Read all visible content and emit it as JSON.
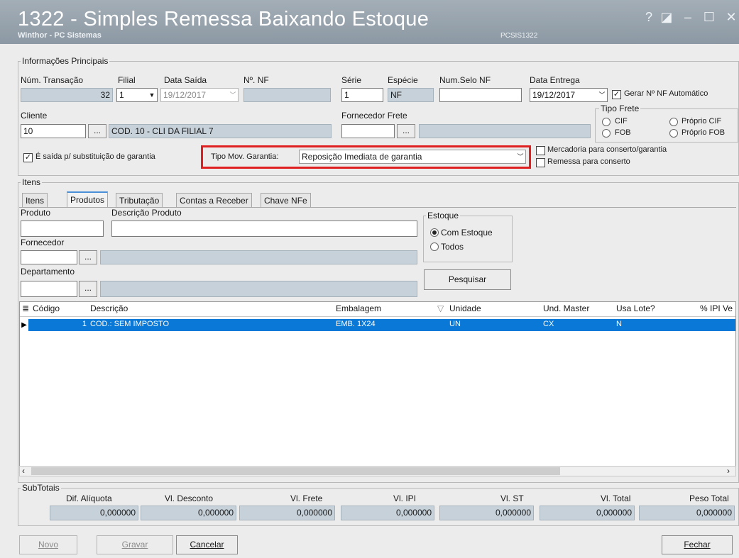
{
  "window": {
    "title": "1322 - Simples Remessa Baixando Estoque",
    "subtitle": "Winthor - PC Sistemas",
    "routine_code": "PCSIS1322",
    "controls": [
      "?",
      "◪",
      "–",
      "☐",
      "✕"
    ]
  },
  "principal": {
    "group_title": "Informações Principais",
    "num_transacao_label": "Núm. Transação",
    "num_transacao_value": "32",
    "filial_label": "Filial",
    "filial_value": "1",
    "data_saida_label": "Data Saída",
    "data_saida_value": "19/12/2017",
    "nf_label": "Nº. NF",
    "nf_value": "",
    "serie_label": "Série",
    "serie_value": "1",
    "especie_label": "Espécie",
    "especie_value": "NF",
    "num_selo_label": "Num.Selo NF",
    "num_selo_value": "",
    "data_entrega_label": "Data Entrega",
    "data_entrega_value": "19/12/2017",
    "gerar_nf_label": "Gerar Nº NF Automático",
    "gerar_nf_checked": true,
    "cliente_label": "Cliente",
    "cliente_code": "10",
    "cliente_name": "COD. 10 - CLI DA FILIAL 7",
    "fornecedor_frete_label": "Fornecedor Frete",
    "fornecedor_frete_code": "",
    "fornecedor_frete_name": "",
    "tipo_frete_title": "Tipo Frete",
    "tipo_frete_options": [
      "CIF",
      "Próprio CIF",
      "FOB",
      "Próprio FOB"
    ],
    "garantia_label": "É saída p/ substituição de garantia",
    "garantia_checked": true,
    "tipo_mov_label": "Tipo Mov. Garantia:",
    "tipo_mov_value": "Reposição Imediata de garantia",
    "mercadoria_conserto_label": "Mercadoria para conserto/garantia",
    "remessa_conserto_label": "Remessa para conserto",
    "ellipsis": "..."
  },
  "itens": {
    "group_title": "Itens",
    "tabs": [
      "Itens",
      "Produtos",
      "Tributação",
      "Contas a Receber",
      "Chave NFe"
    ],
    "active_tab": "Produtos",
    "produto_label": "Produto",
    "descricao_label": "Descrição Produto",
    "fornecedor_label": "Fornecedor",
    "departamento_label": "Departamento",
    "estoque_title": "Estoque",
    "com_estoque_label": "Com Estoque",
    "todos_label": "Todos",
    "pesquisar_label": "Pesquisar"
  },
  "grid": {
    "columns": [
      "Código",
      "Descrição",
      "Embalagem",
      "Unidade",
      "Und. Master",
      "Usa Lote?",
      "% IPI Ve"
    ],
    "rows": [
      {
        "codigo": "1",
        "descricao": "COD.: SEM IMPOSTO",
        "embalagem": "EMB. 1X24",
        "unidade": "UN",
        "und_master": "CX",
        "usa_lote": "N"
      }
    ]
  },
  "subtotais": {
    "title": "SubTotais",
    "labels": [
      "Dif. Alíquota",
      "Vl. Desconto",
      "Vl. Frete",
      "Vl. IPI",
      "Vl. ST",
      "Vl. Total",
      "Peso Total"
    ],
    "values": [
      "0,000000",
      "0,000000",
      "0,000000",
      "0,000000",
      "0,000000",
      "0,000000",
      "0,000000"
    ]
  },
  "footer": {
    "novo": "Novo",
    "gravar": "Gravar",
    "cancelar": "Cancelar",
    "fechar": "Fechar"
  },
  "colors": {
    "titlebar": "#96a2ac",
    "readonly_field": "#c6d1da",
    "selection": "#0a78d7",
    "highlight_box": "#e02020"
  }
}
